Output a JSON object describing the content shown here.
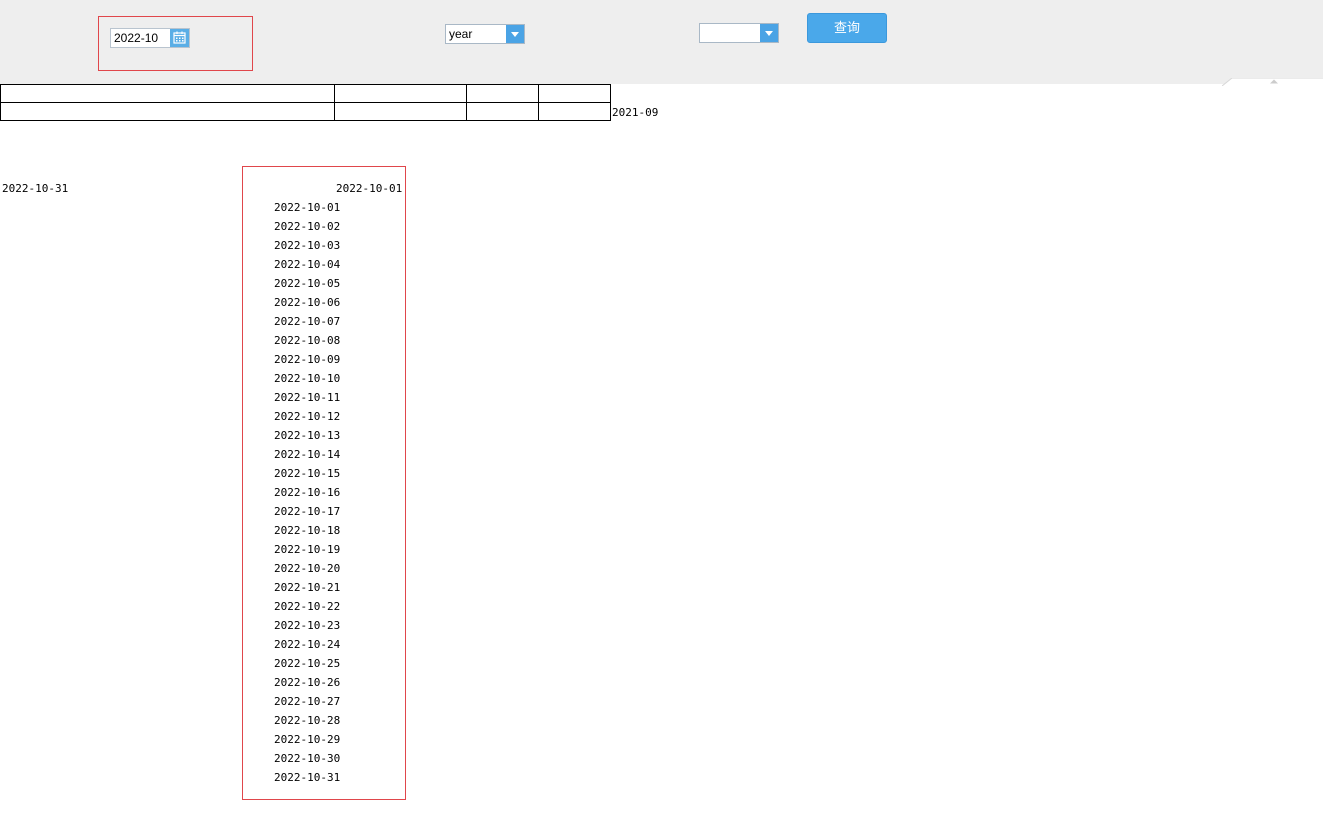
{
  "toolbar": {
    "date_value": "2022-10",
    "calendar_icon": "calendar-icon",
    "period_select": {
      "value": "year"
    },
    "second_select": {
      "value": ""
    },
    "query_label": "查询"
  },
  "table": {
    "rows": [
      [
        "",
        "",
        "",
        ""
      ],
      [
        "",
        "",
        "",
        ""
      ]
    ],
    "side_label": "2021-09"
  },
  "range": {
    "end_date": "2022-10-31",
    "start_date": "2022-10-01"
  },
  "dates": [
    "2022-10-01",
    "2022-10-02",
    "2022-10-03",
    "2022-10-04",
    "2022-10-05",
    "2022-10-06",
    "2022-10-07",
    "2022-10-08",
    "2022-10-09",
    "2022-10-10",
    "2022-10-11",
    "2022-10-12",
    "2022-10-13",
    "2022-10-14",
    "2022-10-15",
    "2022-10-16",
    "2022-10-17",
    "2022-10-18",
    "2022-10-19",
    "2022-10-20",
    "2022-10-21",
    "2022-10-22",
    "2022-10-23",
    "2022-10-24",
    "2022-10-25",
    "2022-10-26",
    "2022-10-27",
    "2022-10-28",
    "2022-10-29",
    "2022-10-30",
    "2022-10-31"
  ],
  "colors": {
    "toolbar_bg": "#eeeeee",
    "accent": "#4aa8ea",
    "highlight": "#e0464b"
  }
}
